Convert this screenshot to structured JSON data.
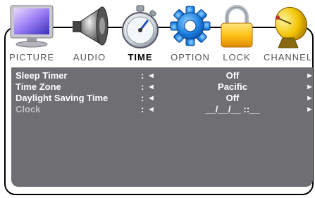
{
  "tabs": [
    {
      "label": "PICTURE",
      "icon": "monitor-icon",
      "active": false
    },
    {
      "label": "AUDIO",
      "icon": "speaker-icon",
      "active": false
    },
    {
      "label": "TIME",
      "icon": "stopwatch-icon",
      "active": true
    },
    {
      "label": "OPTION",
      "icon": "gear-icon",
      "active": false
    },
    {
      "label": "LOCK",
      "icon": "padlock-icon",
      "active": false
    },
    {
      "label": "CHANNEL",
      "icon": "satellite-dish-icon",
      "active": false
    }
  ],
  "settings": [
    {
      "name": "Sleep Timer",
      "colon": ":",
      "left_arrow": "◄",
      "value": "Off",
      "right_arrow": "►",
      "enabled": true
    },
    {
      "name": "Time Zone",
      "colon": ":",
      "left_arrow": "◄",
      "value": "Pacific",
      "right_arrow": "►",
      "enabled": true
    },
    {
      "name": "Daylight Saving Time",
      "colon": ":",
      "left_arrow": "◄",
      "value": "Off",
      "right_arrow": "►",
      "enabled": true
    },
    {
      "name": "Clock",
      "colon": ":",
      "left_arrow": "◄",
      "value": "__/__/__ ::__",
      "right_arrow": "►",
      "enabled": false
    }
  ],
  "colors": {
    "panel": "#6f6f73",
    "active_tab": "#000000",
    "inactive_tab": "#555555",
    "disabled_text": "#bdbdbd"
  }
}
